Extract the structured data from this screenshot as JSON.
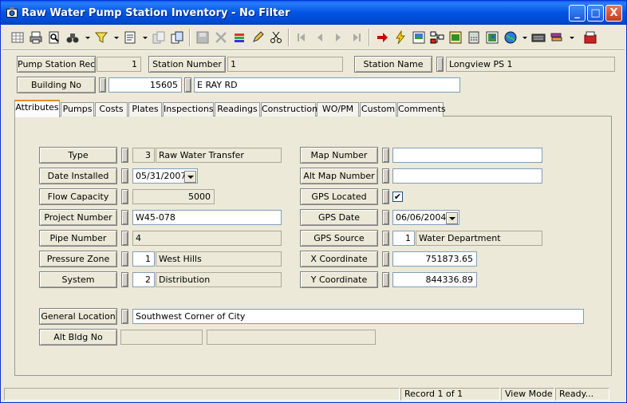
{
  "window": {
    "title": "Raw Water Pump Station Inventory - No Filter",
    "minimize": "_",
    "maximize": "□",
    "close": "X"
  },
  "header": {
    "rec_label": "Pump Station Rec #",
    "rec_value": "1",
    "station_number_label": "Station Number",
    "station_number_value": "1",
    "station_name_label": "Station Name",
    "station_name_value": "Longview PS 1",
    "building_no_label": "Building No",
    "building_no_value": "15605",
    "street_value": "E RAY RD"
  },
  "tabs": [
    "Attributes",
    "Pumps",
    "Costs",
    "Plates",
    "Inspections",
    "Readings",
    "Construction",
    "WO/PM",
    "Custom",
    "Comments"
  ],
  "left_fields": {
    "type_label": "Type",
    "type_code": "3",
    "type_value": "Raw Water Transfer",
    "date_installed_label": "Date Installed",
    "date_installed_value": "05/31/2007",
    "flow_capacity_label": "Flow Capacity",
    "flow_capacity_value": "5000",
    "project_number_label": "Project Number",
    "project_number_value": "W45-078",
    "pipe_number_label": "Pipe Number",
    "pipe_number_value": "4",
    "pressure_zone_label": "Pressure Zone",
    "pressure_zone_code": "1",
    "pressure_zone_value": "West Hills",
    "system_label": "System",
    "system_code": "2",
    "system_value": "Distribution"
  },
  "right_fields": {
    "map_number_label": "Map Number",
    "map_number_value": "",
    "alt_map_number_label": "Alt Map Number",
    "alt_map_number_value": "",
    "gps_located_label": "GPS Located",
    "gps_located_mark": "✔",
    "gps_date_label": "GPS Date",
    "gps_date_value": "06/06/2004",
    "gps_source_label": "GPS Source",
    "gps_source_code": "1",
    "gps_source_value": "Water Department",
    "x_coordinate_label": "X Coordinate",
    "x_coordinate_value": "751873.65",
    "y_coordinate_label": "Y Coordinate",
    "y_coordinate_value": "844336.89"
  },
  "bottom_fields": {
    "general_location_label": "General Location",
    "general_location_value": "Southwest Corner of City",
    "alt_bldg_no_label": "Alt Bldg No"
  },
  "status": {
    "record": "Record 1 of 1",
    "mode": "View Mode",
    "state": "Ready..."
  }
}
